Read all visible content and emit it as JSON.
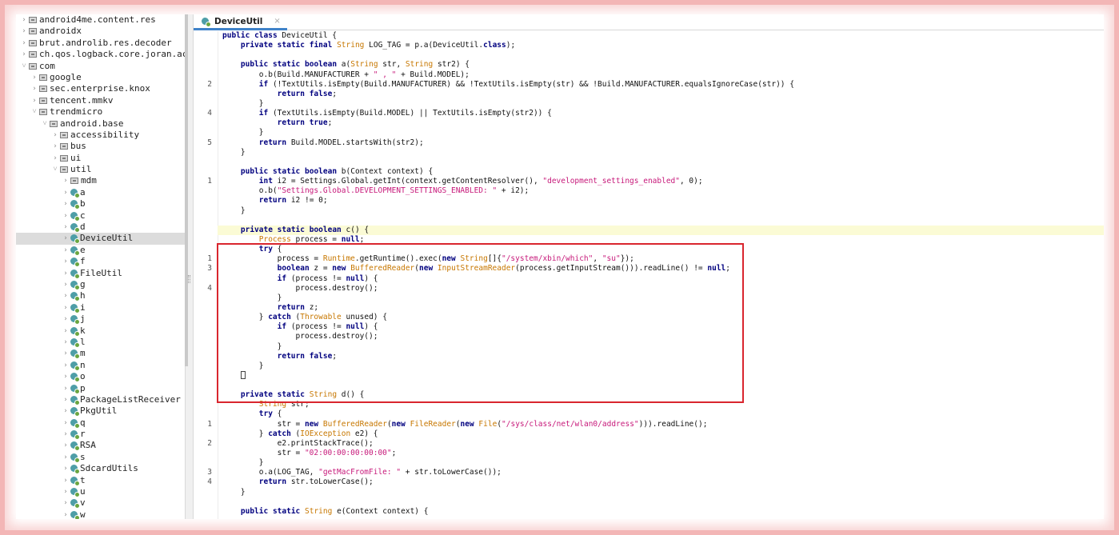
{
  "sidebar": {
    "items": [
      {
        "label": "android4me.content.res",
        "depth": 0,
        "expanded": false,
        "icon": "package-icon"
      },
      {
        "label": "androidx",
        "depth": 0,
        "expanded": false,
        "icon": "package-icon"
      },
      {
        "label": "brut.androlib.res.decoder",
        "depth": 0,
        "expanded": false,
        "icon": "package-icon"
      },
      {
        "label": "ch.qos.logback.core.joran.ac",
        "depth": 0,
        "expanded": false,
        "icon": "package-icon"
      },
      {
        "label": "com",
        "depth": 0,
        "expanded": true,
        "icon": "package-icon"
      },
      {
        "label": "google",
        "depth": 1,
        "expanded": false,
        "icon": "package-icon"
      },
      {
        "label": "sec.enterprise.knox",
        "depth": 1,
        "expanded": false,
        "icon": "package-icon"
      },
      {
        "label": "tencent.mmkv",
        "depth": 1,
        "expanded": false,
        "icon": "package-icon"
      },
      {
        "label": "trendmicro",
        "depth": 1,
        "expanded": true,
        "icon": "package-icon"
      },
      {
        "label": "android.base",
        "depth": 2,
        "expanded": true,
        "icon": "package-icon"
      },
      {
        "label": "accessibility",
        "depth": 3,
        "expanded": false,
        "icon": "package-icon"
      },
      {
        "label": "bus",
        "depth": 3,
        "expanded": false,
        "icon": "package-icon"
      },
      {
        "label": "ui",
        "depth": 3,
        "expanded": false,
        "icon": "package-icon"
      },
      {
        "label": "util",
        "depth": 3,
        "expanded": true,
        "icon": "package-icon"
      },
      {
        "label": "mdm",
        "depth": 4,
        "expanded": false,
        "icon": "package-icon"
      },
      {
        "label": "a",
        "depth": 4,
        "expanded": false,
        "icon": "class-icon"
      },
      {
        "label": "b",
        "depth": 4,
        "expanded": false,
        "icon": "class-icon"
      },
      {
        "label": "c",
        "depth": 4,
        "expanded": false,
        "icon": "class-icon"
      },
      {
        "label": "d",
        "depth": 4,
        "expanded": false,
        "icon": "class-icon"
      },
      {
        "label": "DeviceUtil",
        "depth": 4,
        "expanded": false,
        "icon": "class-icon",
        "selected": true
      },
      {
        "label": "e",
        "depth": 4,
        "expanded": false,
        "icon": "class-icon"
      },
      {
        "label": "f",
        "depth": 4,
        "expanded": false,
        "icon": "class-icon"
      },
      {
        "label": "FileUtil",
        "depth": 4,
        "expanded": false,
        "icon": "class-icon"
      },
      {
        "label": "g",
        "depth": 4,
        "expanded": false,
        "icon": "class-icon"
      },
      {
        "label": "h",
        "depth": 4,
        "expanded": false,
        "icon": "class-icon"
      },
      {
        "label": "i",
        "depth": 4,
        "expanded": false,
        "icon": "class-icon"
      },
      {
        "label": "j",
        "depth": 4,
        "expanded": false,
        "icon": "class-icon"
      },
      {
        "label": "k",
        "depth": 4,
        "expanded": false,
        "icon": "class-icon"
      },
      {
        "label": "l",
        "depth": 4,
        "expanded": false,
        "icon": "class-icon"
      },
      {
        "label": "m",
        "depth": 4,
        "expanded": false,
        "icon": "class-icon"
      },
      {
        "label": "n",
        "depth": 4,
        "expanded": false,
        "icon": "class-icon"
      },
      {
        "label": "o",
        "depth": 4,
        "expanded": false,
        "icon": "class-icon"
      },
      {
        "label": "p",
        "depth": 4,
        "expanded": false,
        "icon": "class-icon"
      },
      {
        "label": "PackageListReceiver",
        "depth": 4,
        "expanded": false,
        "icon": "class-icon"
      },
      {
        "label": "PkgUtil",
        "depth": 4,
        "expanded": false,
        "icon": "class-icon"
      },
      {
        "label": "q",
        "depth": 4,
        "expanded": false,
        "icon": "class-icon"
      },
      {
        "label": "r",
        "depth": 4,
        "expanded": false,
        "icon": "class-icon"
      },
      {
        "label": "RSA",
        "depth": 4,
        "expanded": false,
        "icon": "class-icon"
      },
      {
        "label": "s",
        "depth": 4,
        "expanded": false,
        "icon": "class-icon"
      },
      {
        "label": "SdcardUtils",
        "depth": 4,
        "expanded": false,
        "icon": "class-icon"
      },
      {
        "label": "t",
        "depth": 4,
        "expanded": false,
        "icon": "class-icon"
      },
      {
        "label": "u",
        "depth": 4,
        "expanded": false,
        "icon": "class-icon"
      },
      {
        "label": "v",
        "depth": 4,
        "expanded": false,
        "icon": "class-icon"
      },
      {
        "label": "w",
        "depth": 4,
        "expanded": false,
        "icon": "class-icon"
      }
    ]
  },
  "editor": {
    "tab_label": "DeviceUtil",
    "tab_close": "×",
    "lines": [
      {
        "n": "",
        "t": "public class DeviceUtil {"
      },
      {
        "n": "",
        "t": "    private static final String LOG_TAG = p.a(DeviceUtil.class);"
      },
      {
        "n": "",
        "t": ""
      },
      {
        "n": "",
        "t": "    public static boolean a(String str, String str2) {"
      },
      {
        "n": "",
        "t": "        o.b(Build.MANUFACTURER + \" , \" + Build.MODEL);"
      },
      {
        "n": "2",
        "t": "        if (!TextUtils.isEmpty(Build.MANUFACTURER) && !TextUtils.isEmpty(str) && !Build.MANUFACTURER.equalsIgnoreCase(str)) {"
      },
      {
        "n": "",
        "t": "            return false;"
      },
      {
        "n": "",
        "t": "        }"
      },
      {
        "n": "4",
        "t": "        if (TextUtils.isEmpty(Build.MODEL) || TextUtils.isEmpty(str2)) {"
      },
      {
        "n": "",
        "t": "            return true;"
      },
      {
        "n": "",
        "t": "        }"
      },
      {
        "n": "5",
        "t": "        return Build.MODEL.startsWith(str2);"
      },
      {
        "n": "",
        "t": "    }"
      },
      {
        "n": "",
        "t": ""
      },
      {
        "n": "",
        "t": "    public static boolean b(Context context) {"
      },
      {
        "n": "1",
        "t": "        int i2 = Settings.Global.getInt(context.getContentResolver(), \"development_settings_enabled\", 0);"
      },
      {
        "n": "",
        "t": "        o.b(\"Settings.Global.DEVELOPMENT_SETTINGS_ENABLED: \" + i2);"
      },
      {
        "n": "",
        "t": "        return i2 != 0;"
      },
      {
        "n": "",
        "t": "    }"
      },
      {
        "n": "",
        "t": ""
      },
      {
        "n": "",
        "t": "    private static boolean c() {",
        "hl": true
      },
      {
        "n": "",
        "t": "        Process process = null;"
      },
      {
        "n": "",
        "t": "        try {"
      },
      {
        "n": "1",
        "t": "            process = Runtime.getRuntime().exec(new String[]{\"/system/xbin/which\", \"su\"});"
      },
      {
        "n": "3",
        "t": "            boolean z = new BufferedReader(new InputStreamReader(process.getInputStream())).readLine() != null;"
      },
      {
        "n": "",
        "t": "            if (process != null) {"
      },
      {
        "n": "4",
        "t": "                process.destroy();"
      },
      {
        "n": "",
        "t": "            }"
      },
      {
        "n": "",
        "t": "            return z;"
      },
      {
        "n": "",
        "t": "        } catch (Throwable unused) {"
      },
      {
        "n": "",
        "t": "            if (process != null) {"
      },
      {
        "n": "",
        "t": "                process.destroy();"
      },
      {
        "n": "",
        "t": "            }"
      },
      {
        "n": "",
        "t": "            return false;"
      },
      {
        "n": "",
        "t": "        }"
      },
      {
        "n": "",
        "t": "    }",
        "cursor": true
      },
      {
        "n": "",
        "t": ""
      },
      {
        "n": "",
        "t": "    private static String d() {"
      },
      {
        "n": "",
        "t": "        String str;"
      },
      {
        "n": "",
        "t": "        try {"
      },
      {
        "n": "1",
        "t": "            str = new BufferedReader(new FileReader(new File(\"/sys/class/net/wlan0/address\"))).readLine();"
      },
      {
        "n": "",
        "t": "        } catch (IOException e2) {"
      },
      {
        "n": "2",
        "t": "            e2.printStackTrace();"
      },
      {
        "n": "",
        "t": "            str = \"02:00:00:00:00:00\";"
      },
      {
        "n": "",
        "t": "        }"
      },
      {
        "n": "3",
        "t": "        o.a(LOG_TAG, \"getMacFromFile: \" + str.toLowerCase());"
      },
      {
        "n": "4",
        "t": "        return str.toLowerCase();"
      },
      {
        "n": "",
        "t": "    }"
      },
      {
        "n": "",
        "t": ""
      },
      {
        "n": "",
        "t": "    public static String e(Context context) {"
      }
    ]
  },
  "colors": {
    "keyword": "#00007f",
    "type": "#c77700",
    "string": "#c7197a",
    "highlight_box": "#d9262e",
    "current_line": "#fbfbd5",
    "tab_underline": "#4083c9"
  }
}
